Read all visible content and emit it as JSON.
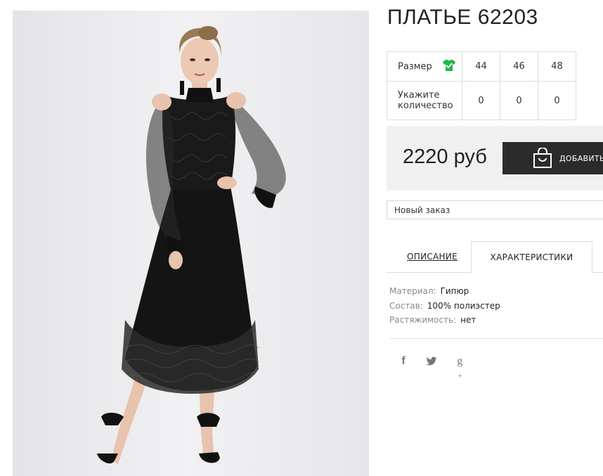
{
  "product": {
    "title": "ПЛАТЬЕ 62203",
    "image_alt": "Black lace midi dress photo"
  },
  "sizes": {
    "row_label": "Размер",
    "values": [
      "44",
      "46",
      "48"
    ],
    "qty_label_line1": "Укажите",
    "qty_label_line2": "количество",
    "quantities": [
      "0",
      "0",
      "0"
    ],
    "tick_icon": "tshirt-check-icon",
    "tick_color": "#1fb84a"
  },
  "purchase": {
    "price": "2220 руб",
    "add_button_label": "ДОБАВИТЬ",
    "button_icon": "shopping-bag-icon",
    "order_type": "Новый заказ"
  },
  "tabs": {
    "description": "ОПИСАНИЕ",
    "characteristics": "ХАРАКТЕРИСТИКИ",
    "active": "characteristics"
  },
  "characteristics": [
    {
      "key": "Материал:",
      "value": "Гипюр"
    },
    {
      "key": "Состав:",
      "value": "100% полиэстер"
    },
    {
      "key": "Растяжимость:",
      "value": "нет"
    }
  ],
  "social": {
    "facebook": "f",
    "googleplus": "g",
    "googleplus_sup": "+",
    "icons": [
      "facebook-icon",
      "twitter-icon",
      "google-plus-icon"
    ]
  }
}
